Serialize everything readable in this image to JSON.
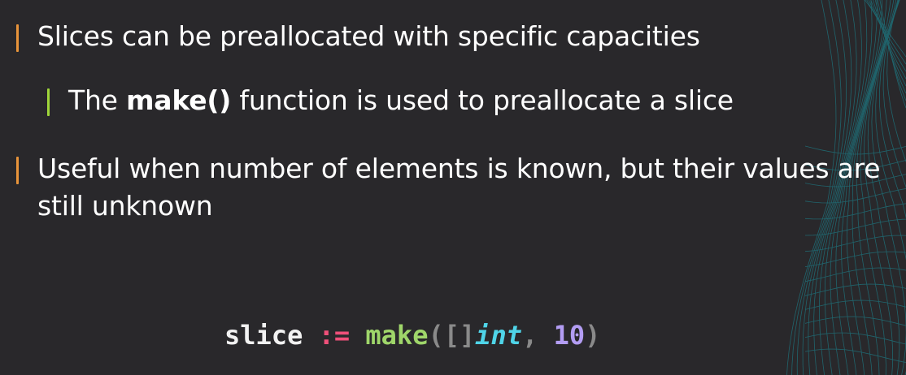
{
  "bullets": [
    {
      "text": "Slices can be preallocated with specific capacities"
    },
    {
      "before": "The ",
      "bold": "make()",
      "after": " function is used to preallocate a slice"
    },
    {
      "text": "Useful when number of elements is known, but their values are still unknown"
    }
  ],
  "code": {
    "ident": "slice",
    "op": ":=",
    "fn": "make",
    "open": "([]",
    "type": "int",
    "comma": ",",
    "num": "10",
    "close": ")"
  },
  "colors": {
    "background": "#29282b",
    "bar_primary": "#e8943a",
    "bar_secondary": "#9fd63a",
    "decoration": "#1f6f78"
  },
  "decoration": "wireframe-mesh-corner"
}
